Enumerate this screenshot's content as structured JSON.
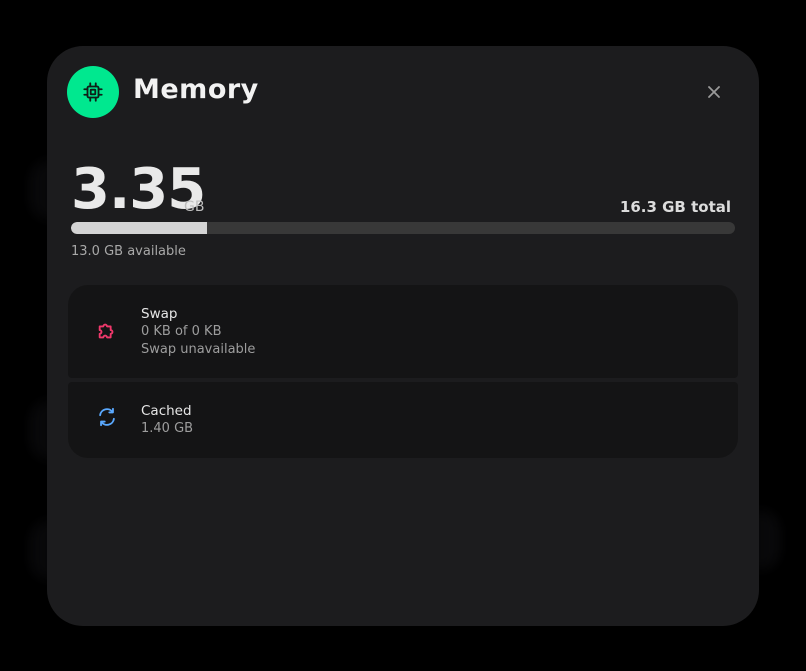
{
  "header": {
    "title": "Memory",
    "icon": "cpu-chip-icon",
    "accent_color": "#00e88f",
    "close_icon": "close-icon"
  },
  "usage": {
    "value": "3.35",
    "unit": "GB",
    "total_label": "16.3 GB total",
    "available_label": "13.0 GB available",
    "used_fraction": 0.205
  },
  "details": {
    "swap": {
      "icon": "puzzle-icon",
      "icon_color": "#f0386b",
      "title": "Swap",
      "line1": "0 KB of 0 KB",
      "line2": "Swap unavailable"
    },
    "cached": {
      "icon": "refresh-icon",
      "icon_color": "#5aa9ff",
      "title": "Cached",
      "line1": "1.40 GB"
    }
  }
}
